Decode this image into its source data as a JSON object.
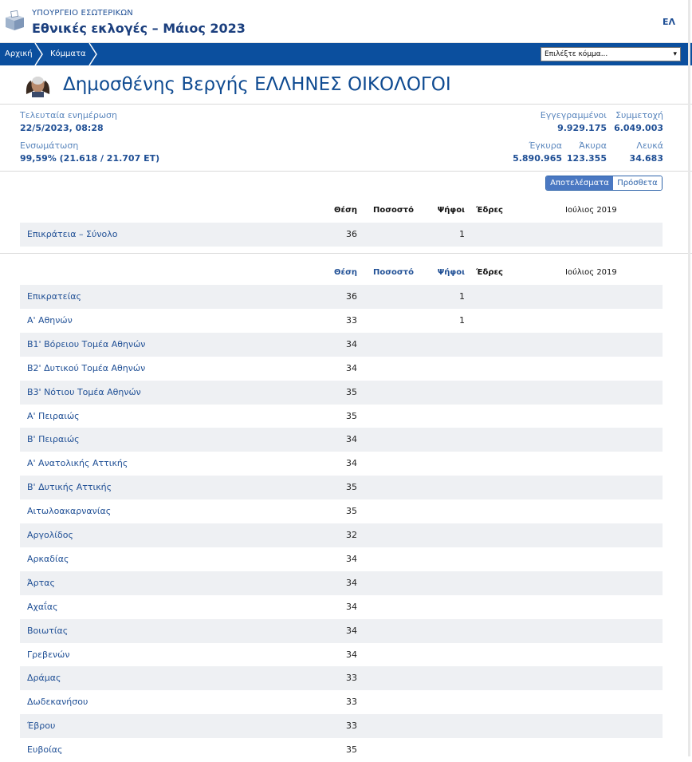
{
  "header": {
    "ministry": "ΥΠΟΥΡΓΕΙΟ ΕΣΩΤΕΡΙΚΩΝ",
    "election_title": "Εθνικές εκλογές – Μάιος 2023",
    "language": "ΕΛ",
    "logo_icon": "ballot-box-icon"
  },
  "nav": {
    "breadcrumbs": [
      "Αρχική",
      "Κόμματα"
    ],
    "party_select_placeholder": "Επιλέξτε κόμμα...",
    "bar_color": "#0b4f9e"
  },
  "party": {
    "title": "Δημοσθένης Βεργής ΕΛΛΗΝΕΣ ΟΙΚΟΛΟΓΟΙ",
    "avatar_icon": "party-leader-avatar"
  },
  "stats": {
    "last_update_label": "Τελευταία ενημέρωση",
    "last_update_value": "22/5/2023, 08:28",
    "integration_label": "Ενσωμάτωση",
    "integration_value": "99,59% (21.618 / 21.707 ΕΤ)",
    "registered_label": "Εγγεγραμμένοι",
    "registered_value": "9.929.175",
    "turnout_label": "Συμμετοχή",
    "turnout_value": "6.049.003",
    "valid_label": "Έγκυρα",
    "valid_value": "5.890.965",
    "invalid_label": "Άκυρα",
    "invalid_value": "123.355",
    "blank_label": "Λευκά",
    "blank_value": "34.683"
  },
  "tabs": {
    "results": "Αποτελέσματα",
    "extra": "Πρόσθετα"
  },
  "columns": {
    "position": "Θέση",
    "percent": "Ποσοστό",
    "votes": "Ψήφοι",
    "seats": "Έδρες",
    "previous": "Ιούλιος 2019"
  },
  "state_table": [
    {
      "name": "Επικράτεια – Σύνολο",
      "position": "36",
      "votes": "1"
    }
  ],
  "constituency_table": [
    {
      "name": "Επικρατείας",
      "position": "36",
      "votes": "1"
    },
    {
      "name": "Α' Αθηνών",
      "position": "33",
      "votes": "1"
    },
    {
      "name": "Β1' Βόρειου Τομέα Αθηνών",
      "position": "34",
      "votes": ""
    },
    {
      "name": "Β2' Δυτικού Τομέα Αθηνών",
      "position": "34",
      "votes": ""
    },
    {
      "name": "Β3' Νότιου Τομέα Αθηνών",
      "position": "35",
      "votes": ""
    },
    {
      "name": "Α' Πειραιώς",
      "position": "35",
      "votes": ""
    },
    {
      "name": "Β' Πειραιώς",
      "position": "34",
      "votes": ""
    },
    {
      "name": "Α' Ανατολικής Αττικής",
      "position": "34",
      "votes": ""
    },
    {
      "name": "Β' Δυτικής Αττικής",
      "position": "35",
      "votes": ""
    },
    {
      "name": "Αιτωλοακαρνανίας",
      "position": "35",
      "votes": ""
    },
    {
      "name": "Αργολίδος",
      "position": "32",
      "votes": ""
    },
    {
      "name": "Αρκαδίας",
      "position": "34",
      "votes": ""
    },
    {
      "name": "Άρτας",
      "position": "34",
      "votes": ""
    },
    {
      "name": "Αχαΐας",
      "position": "34",
      "votes": ""
    },
    {
      "name": "Βοιωτίας",
      "position": "34",
      "votes": ""
    },
    {
      "name": "Γρεβενών",
      "position": "34",
      "votes": ""
    },
    {
      "name": "Δράμας",
      "position": "33",
      "votes": ""
    },
    {
      "name": "Δωδεκανήσου",
      "position": "33",
      "votes": ""
    },
    {
      "name": "Έβρου",
      "position": "33",
      "votes": ""
    },
    {
      "name": "Ευβοίας",
      "position": "35",
      "votes": ""
    }
  ]
}
